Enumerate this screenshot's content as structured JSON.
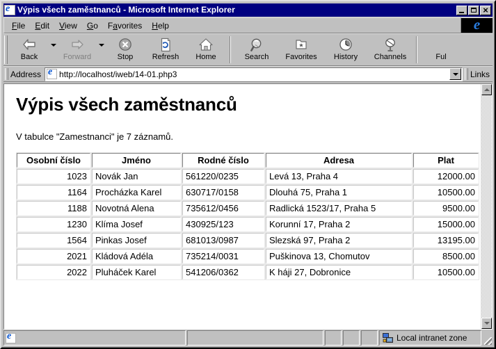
{
  "window": {
    "title": "Výpis všech zaměstnanců - Microsoft Internet Explorer",
    "title_icon": "ie-document-icon",
    "minimize_label": "Minimize",
    "maximize_label": "Maximize",
    "close_label": "Close"
  },
  "menubar": {
    "items": [
      {
        "label": "File",
        "accel": "F"
      },
      {
        "label": "Edit",
        "accel": "E"
      },
      {
        "label": "View",
        "accel": "V"
      },
      {
        "label": "Go",
        "accel": "G"
      },
      {
        "label": "Favorites",
        "accel": "a"
      },
      {
        "label": "Help",
        "accel": "H"
      }
    ],
    "logo": "ie-animated-logo"
  },
  "toolbar": {
    "buttons": [
      {
        "label": "Back",
        "icon": "back-arrow-icon",
        "disabled": false,
        "has_dropdown": true
      },
      {
        "label": "Forward",
        "icon": "forward-arrow-icon",
        "disabled": true,
        "has_dropdown": true
      },
      {
        "label": "Stop",
        "icon": "stop-icon",
        "disabled": false,
        "has_dropdown": false
      },
      {
        "label": "Refresh",
        "icon": "refresh-icon",
        "disabled": false,
        "has_dropdown": false
      },
      {
        "label": "Home",
        "icon": "home-icon",
        "disabled": false,
        "has_dropdown": false
      },
      {
        "label": "Search",
        "icon": "search-icon",
        "disabled": false,
        "has_dropdown": false
      },
      {
        "label": "Favorites",
        "icon": "favorites-folder-icon",
        "disabled": false,
        "has_dropdown": false
      },
      {
        "label": "History",
        "icon": "history-clock-icon",
        "disabled": false,
        "has_dropdown": false
      },
      {
        "label": "Channels",
        "icon": "channels-satellite-icon",
        "disabled": false,
        "has_dropdown": false
      },
      {
        "label": "Ful",
        "icon": "fullscreen-icon",
        "disabled": false,
        "has_dropdown": false
      }
    ]
  },
  "address": {
    "label": "Address",
    "icon": "ie-document-icon",
    "url": "http://localhost/iweb/14-01.php3",
    "dropdown_icon": "chevron-down-icon",
    "links_label": "Links"
  },
  "page": {
    "title": "Výpis všech zaměstnanců",
    "intro": "V tabulce \"Zamestnanci\" je 7 záznamů.",
    "table": {
      "headers": [
        "Osobní číslo",
        "Jméno",
        "Rodné číslo",
        "Adresa",
        "Plat"
      ],
      "rows": [
        [
          "1023",
          "Novák Jan",
          "561220/0235",
          "Levá 13, Praha 4",
          "12000.00"
        ],
        [
          "1164",
          "Procházka Karel",
          "630717/0158",
          "Dlouhá 75, Praha 1",
          "10500.00"
        ],
        [
          "1188",
          "Novotná Alena",
          "735612/0456",
          "Radlická 1523/17, Praha 5",
          "9500.00"
        ],
        [
          "1230",
          "Klíma Josef",
          "430925/123",
          "Korunní 17, Praha 2",
          "15000.00"
        ],
        [
          "1564",
          "Pinkas Josef",
          "681013/0987",
          "Slezská 97, Praha 2",
          "13195.00"
        ],
        [
          "2021",
          "Kládová Adéla",
          "735214/0031",
          "Puškinova 13, Chomutov",
          "8500.00"
        ],
        [
          "2022",
          "Pluháček Karel",
          "541206/0362",
          "K háji 27, Dobronice",
          "10500.00"
        ]
      ]
    }
  },
  "scrollbar": {
    "up_icon": "scroll-up-arrow-icon",
    "down_icon": "scroll-down-arrow-icon"
  },
  "statusbar": {
    "main_text": "",
    "progress_text": "",
    "zone_icon": "network-zone-icon",
    "zone_text": "Local intranet zone"
  },
  "colors": {
    "titlebar": "#000080",
    "chrome": "#c0c0c0",
    "page_bg": "#ffffff",
    "text": "#000000",
    "disabled_text": "#808080"
  }
}
